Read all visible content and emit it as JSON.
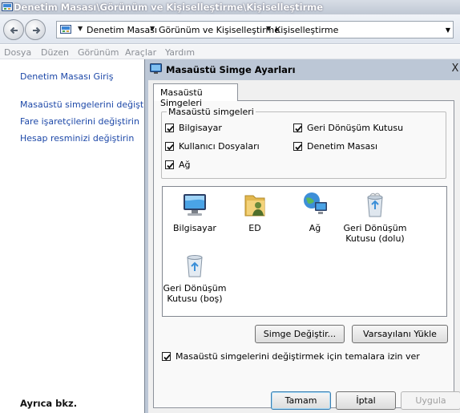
{
  "window": {
    "title": "Denetim Masası\\Görünüm ve Kişiselleştirme\\Kişiselleştirme"
  },
  "navigation": {
    "breadcrumb": [
      "Denetim Masası",
      "Görünüm ve Kişiselleştirme",
      "Kişiselleştirme"
    ]
  },
  "menu": [
    "Dosya",
    "Düzen",
    "Görünüm",
    "Araçlar",
    "Yardım"
  ],
  "left_pane": {
    "home_link": "Denetim Masası Giriş",
    "links": [
      "Masaüstü simgelerini değiştirin",
      "Fare işaretçilerini değiştirin",
      "Hesap resminizi değiştirin"
    ],
    "see_also": "Ayrıca bkz."
  },
  "dialog": {
    "title": "Masaüstü Simge Ayarları",
    "close_symbol": "X",
    "tab": "Masaüstü Simgeleri",
    "group_label": "Masaüstü simgeleri",
    "checkboxes": [
      {
        "label": "Bilgisayar",
        "checked": true
      },
      {
        "label": "Geri Dönüşüm Kutusu",
        "checked": true
      },
      {
        "label": "Kullanıcı Dosyaları",
        "checked": true
      },
      {
        "label": "Denetim Masası",
        "checked": true
      },
      {
        "label": "Ağ",
        "checked": true
      }
    ],
    "icons": [
      {
        "label": "Bilgisayar",
        "icon": "computer-icon"
      },
      {
        "label": "ED",
        "icon": "user-folder-icon"
      },
      {
        "label": "Ağ",
        "icon": "network-icon"
      },
      {
        "label": "Geri Dönüşüm Kutusu (dolu)",
        "icon": "recycle-bin-full-icon"
      },
      {
        "label": "Geri Dönüşüm Kutusu (boş)",
        "icon": "recycle-bin-empty-icon"
      }
    ],
    "change_icon_button": "Simge Değiştir...",
    "restore_default_button": "Varsayılanı Yükle",
    "themes_checkbox": {
      "label": "Masaüstü simgelerini değiştirmek için temalara izin ver",
      "checked": true
    },
    "ok_button": "Tamam",
    "cancel_button": "İptal",
    "apply_button": "Uygula"
  }
}
